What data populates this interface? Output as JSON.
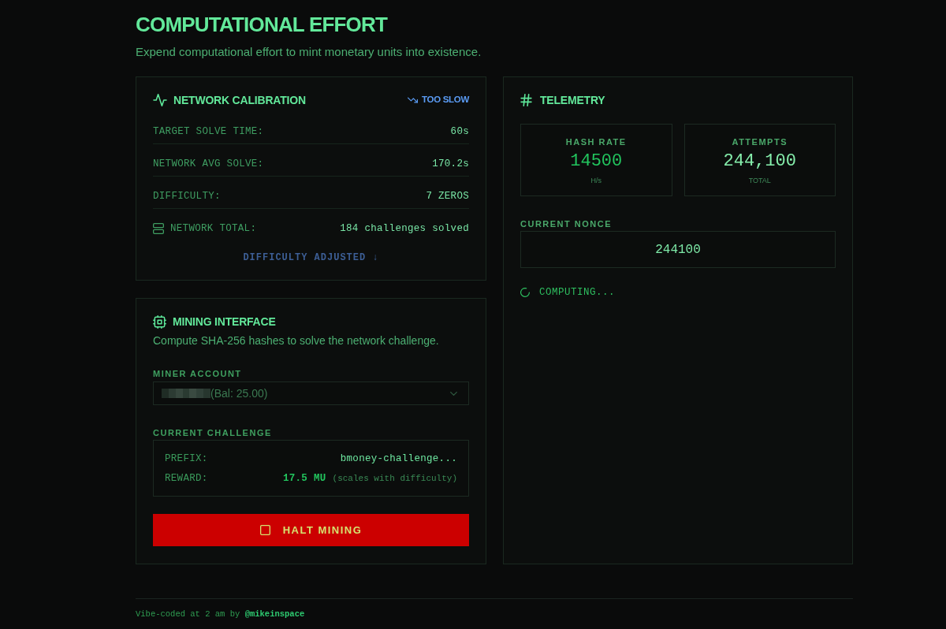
{
  "header": {
    "title": "COMPUTATIONAL EFFORT",
    "subtitle": "Expend computational effort to mint monetary units into existence."
  },
  "calibration": {
    "title": "NETWORK CALIBRATION",
    "status": "TOO SLOW",
    "rows": [
      {
        "kind": "metric",
        "label": "TARGET SOLVE TIME:",
        "value": "60s"
      },
      {
        "kind": "metric",
        "label": "NETWORK AVG SOLVE:",
        "value": "170.2s"
      },
      {
        "kind": "metric",
        "label": "DIFFICULTY:",
        "value": "7 ZEROS"
      },
      {
        "kind": "total",
        "label": "NETWORK TOTAL:",
        "value": "184 challenges solved"
      }
    ],
    "adjustment": "DIFFICULTY ADJUSTED ↓"
  },
  "mining": {
    "title": "MINING INTERFACE",
    "description": "Compute SHA-256 hashes to solve the network challenge.",
    "account": {
      "label": "MINER ACCOUNT",
      "value": "(Bal: 25.00)"
    },
    "challenge": {
      "label": "CURRENT CHALLENGE",
      "rows": [
        {
          "kind": "text",
          "label": "PREFIX:",
          "value": "bmoney-challenge..."
        },
        {
          "kind": "reward",
          "label": "REWARD:",
          "value": "17.5 MU",
          "note": "(scales with difficulty)"
        }
      ]
    },
    "action": {
      "label": "HALT MINING"
    }
  },
  "telemetry": {
    "title": "TELEMETRY",
    "stats": [
      {
        "label": "HASH RATE",
        "value": "14500",
        "unit": "H/s",
        "color": "#22c55e"
      },
      {
        "label": "ATTEMPTS",
        "value": "244,100",
        "unit": "TOTAL",
        "color": "#86efac"
      }
    ],
    "nonce": {
      "label": "CURRENT NONCE",
      "value": "244100"
    },
    "status": "COMPUTING..."
  },
  "footer": {
    "text": "Vibe-coded at 2 am by",
    "link": "@mikeinspace"
  }
}
